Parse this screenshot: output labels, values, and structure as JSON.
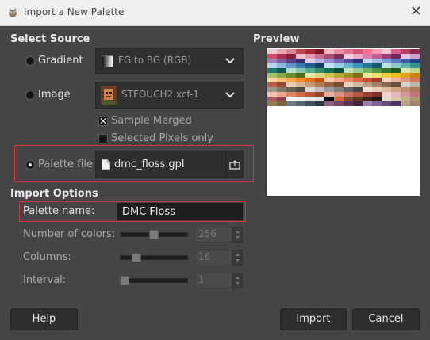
{
  "window": {
    "title": "Import a New Palette",
    "close_glyph": "✕"
  },
  "select_source": {
    "heading": "Select Source",
    "gradient": {
      "label": "Gradient",
      "value": "FG to BG (RGB)"
    },
    "image": {
      "label": "Image",
      "value": "STFOUCH2.xcf-1"
    },
    "sample_merged": {
      "label": "Sample Merged",
      "checked": true
    },
    "selected_pixels_only": {
      "label": "Selected Pixels only",
      "checked": false
    },
    "palette_file": {
      "label": "Palette file",
      "value": "dmc_floss.gpl"
    }
  },
  "import_options": {
    "heading": "Import Options",
    "palette_name": {
      "label": "Palette name:",
      "value": "DMC Floss"
    },
    "number_of_colors": {
      "label": "Number of colors:",
      "value": "256",
      "fraction": 0.5
    },
    "columns": {
      "label": "Columns:",
      "value": "16",
      "fraction": 0.2
    },
    "interval": {
      "label": "Interval:",
      "value": "1",
      "fraction": 0.0
    }
  },
  "preview": {
    "heading": "Preview",
    "colors": [
      "#f2ced2",
      "#e9a7b0",
      "#d6868e",
      "#c04450",
      "#a52a36",
      "#7a1a26",
      "#f6b6c6",
      "#ee8ea4",
      "#e8718f",
      "#d95376",
      "#ff6f8e",
      "#f79ab0",
      "#fbc6d3",
      "#d85f8c",
      "#bb3e6d",
      "#8e2a52",
      "#cf4a6d",
      "#b02c52",
      "#8b1f3e",
      "#f3c0cf",
      "#e29ab2",
      "#c9708f",
      "#a84c72",
      "#7c2e54",
      "#f5d0de",
      "#eaa9c5",
      "#d583ad",
      "#b95d93",
      "#9a3f78",
      "#6e2a5c",
      "#e3c6e0",
      "#c9a2cf",
      "#a57fbb",
      "#815ea2",
      "#5e4184",
      "#3d2c66",
      "#d7d1ec",
      "#b8afde",
      "#978ccd",
      "#7566b6",
      "#52459b",
      "#352f7a",
      "#c9d6ef",
      "#a6bce6",
      "#7f9cd6",
      "#5b7cc1",
      "#3d5ca8",
      "#243f85",
      "#b8d3ea",
      "#8cb7dc",
      "#5d96c7",
      "#3a77ad",
      "#255a8c",
      "#163f66",
      "#c6e4ef",
      "#95cde3",
      "#62b2d1",
      "#3a93b8",
      "#217595",
      "#145771",
      "#bfe2e0",
      "#8ccdc9",
      "#58b3ad",
      "#30958f",
      "#1e7670",
      "#125650",
      "#b5dccb",
      "#85c6ad",
      "#55ab8c",
      "#2f8c6c",
      "#1c6c52",
      "#0f4d3a",
      "#c3e0b8",
      "#9ccb8d",
      "#74b266",
      "#519446",
      "#367632",
      "#215a22",
      "#dbe8b0",
      "#c0d88a",
      "#a2c364",
      "#86aa45",
      "#6b8d2f",
      "#51701f",
      "#ede7a8",
      "#e1d77a",
      "#d0c252",
      "#bba935",
      "#9f8c23",
      "#7e6e16",
      "#f8eb9a",
      "#f6df6c",
      "#f4cf3d",
      "#f0bb1e",
      "#e59f10",
      "#c9820a",
      "#fdd7a0",
      "#fcc072",
      "#f9a54a",
      "#f18a2c",
      "#e06d18",
      "#c1520d",
      "#fbc9b2",
      "#f7a88b",
      "#f08466",
      "#e46446",
      "#cc4a31",
      "#a83623",
      "#f7d2c4",
      "#eeb49f",
      "#e2957d",
      "#d2765e",
      "#bb5c45",
      "#9c4533",
      "#e9cdb8",
      "#dab295",
      "#c79676",
      "#b17b5b",
      "#956244",
      "#774c33",
      "#e4d3c0",
      "#d0b99f",
      "#b89c80",
      "#9e8165",
      "#82684f",
      "#67513d",
      "#d8d2c8",
      "#bdb5a8",
      "#9f9788",
      "#827a6c",
      "#676054",
      "#4e4840",
      "#d9d9d9",
      "#bdbdbd",
      "#9e9e9e",
      "#808080",
      "#636363",
      "#474747",
      "#f3e2d4",
      "#ead0bb",
      "#dfbba0",
      "#d1a585",
      "#c08e6d",
      "#a97656",
      "#f4c2a8",
      "#eca487",
      "#e08767",
      "#d06b4b",
      "#b85536",
      "#9a4227",
      "#e9b3a4",
      "#dc9281",
      "#cb7363",
      "#b55649",
      "#9a3f35",
      "#7c2e27",
      "#f1d6d9",
      "#e6b6bc",
      "#d6959e",
      "#c27580",
      "#a95864",
      "#8d414c",
      "#ffffff",
      "#f5f5f5",
      "#ebebeb",
      "#e0e0e0",
      "#000000",
      "#d26a2a",
      "#7b4a2c",
      "#5c3620",
      "#3f2416",
      "#2a180e",
      "#e7dccc",
      "#d9c8ae",
      "#c6af8e",
      "#b09670",
      "#967c56",
      "#7b6340",
      "#6a7b86",
      "#536570",
      "#3e4f5a",
      "#2b3b45",
      "#8e5f7c",
      "#744866",
      "#5a334f",
      "#43233b",
      "#9a7fb0",
      "#7e6496",
      "#634b7b",
      "#4a3562",
      "#b7a28a",
      "#9c8771"
    ]
  }
}
